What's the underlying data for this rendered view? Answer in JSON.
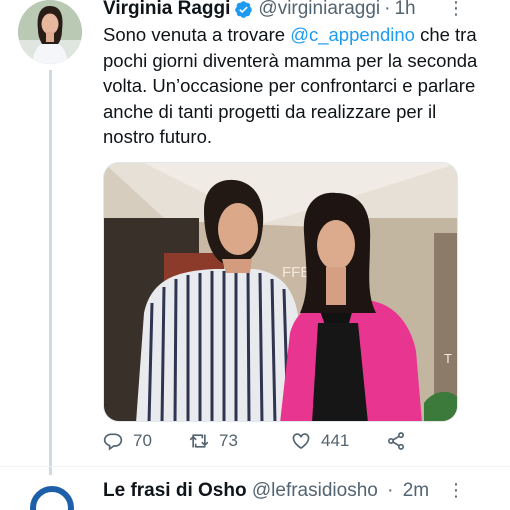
{
  "tweet": {
    "author_name": "Virginia Raggi",
    "author_handle": "@virginiaraggi",
    "separator": "·",
    "time": "1h",
    "more": "⋮",
    "text_before_mention": "Sono venuta a trovare ",
    "mention": "@c_appendino",
    "text_after_mention": " che tra pochi giorni diventerà mamma per la seconda volta. Un’occasione per confrontarci e parlare anche di tanti progetti da realizzare per il nostro futuro.",
    "photo_sign_text": "FFETTIG",
    "photo_side_sign": "T",
    "actions": {
      "reply_count": "70",
      "retweet_count": "73",
      "like_count": "441"
    }
  },
  "next_tweet": {
    "author_name": "Le frasi di Osho",
    "author_handle": "@lefrasidiosho",
    "separator": "·",
    "time": "2m",
    "more": "⋮"
  },
  "colors": {
    "accent": "#1d9bf0",
    "secondary_text": "#536471",
    "primary_text": "#0f1419"
  }
}
